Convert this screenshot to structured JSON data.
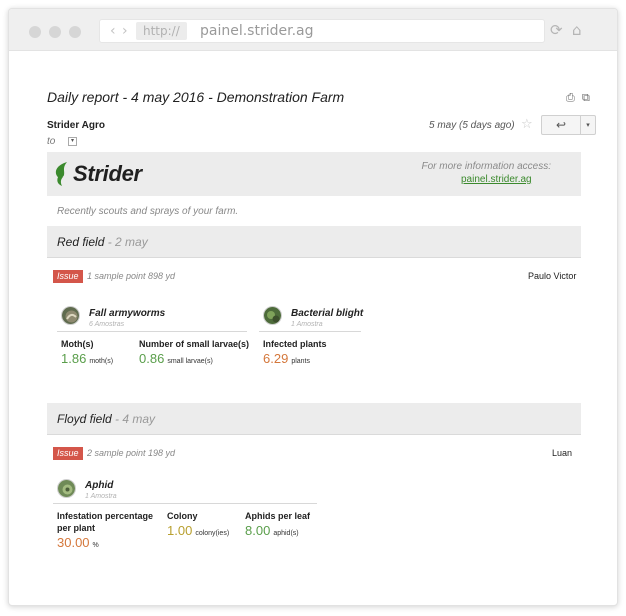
{
  "browser": {
    "protocol": "http://",
    "domain": "painel.strider.ag",
    "back_glyph": "‹",
    "forward_glyph": "›",
    "reload_glyph": "⟳",
    "home_glyph": "⌂"
  },
  "email": {
    "subject": "Daily report - 4 may 2016 - Demonstration Farm",
    "sender": "Strider Agro",
    "to_label": "to",
    "date": "5 may (5 days ago)",
    "star_glyph": "☆",
    "reply_glyph": "↩",
    "more_glyph": "▾",
    "print_glyph": "⎙",
    "popout_glyph": "⧉"
  },
  "report": {
    "brand": "Strider",
    "more_info_label": "For more information access:",
    "more_info_link": "painel.strider.ag",
    "intro": "Recently scouts and sprays of your farm.",
    "issue_label": "Issue"
  },
  "fields": [
    {
      "name": "Red field",
      "date": " - 2 may",
      "sample": "1 sample point 898 yd",
      "scout": "Paulo Victor",
      "pests": [
        {
          "name": "Fall armyworms",
          "samples": "6 Amostras",
          "icon": "armyworm-icon",
          "metrics": [
            {
              "label": "Moth(s)",
              "value": "1.86",
              "unit": "moth(s)"
            },
            {
              "label": "Number of small larvae(s)",
              "value": "0.86",
              "unit": "small larvae(s)"
            }
          ]
        },
        {
          "name": "Bacterial blight",
          "samples": "1 Amostra",
          "icon": "bacterial-blight-icon",
          "metrics": [
            {
              "label": "Infected plants",
              "value": "6.29",
              "unit": "plants"
            }
          ]
        }
      ]
    },
    {
      "name": "Floyd field",
      "date": " - 4 may",
      "sample": "2  sample point 198 yd",
      "scout": "Luan",
      "pests": [
        {
          "name": "Aphid",
          "samples": "1 Amostra",
          "icon": "aphid-icon",
          "metrics": [
            {
              "label": "Infestation percentage per plant",
              "value": "30.00",
              "unit": "%"
            },
            {
              "label": "Colony",
              "value": "1.00",
              "unit": "colony(ies)"
            },
            {
              "label": "Aphids per leaf",
              "value": "8.00",
              "unit": "aphid(s)"
            }
          ]
        }
      ]
    }
  ],
  "colors": {
    "brand_green": "#3b8a2d",
    "issue_red": "#d4564a",
    "value_green": "#5a9e4b",
    "value_orange": "#d4773b",
    "value_olive": "#b8a030"
  }
}
